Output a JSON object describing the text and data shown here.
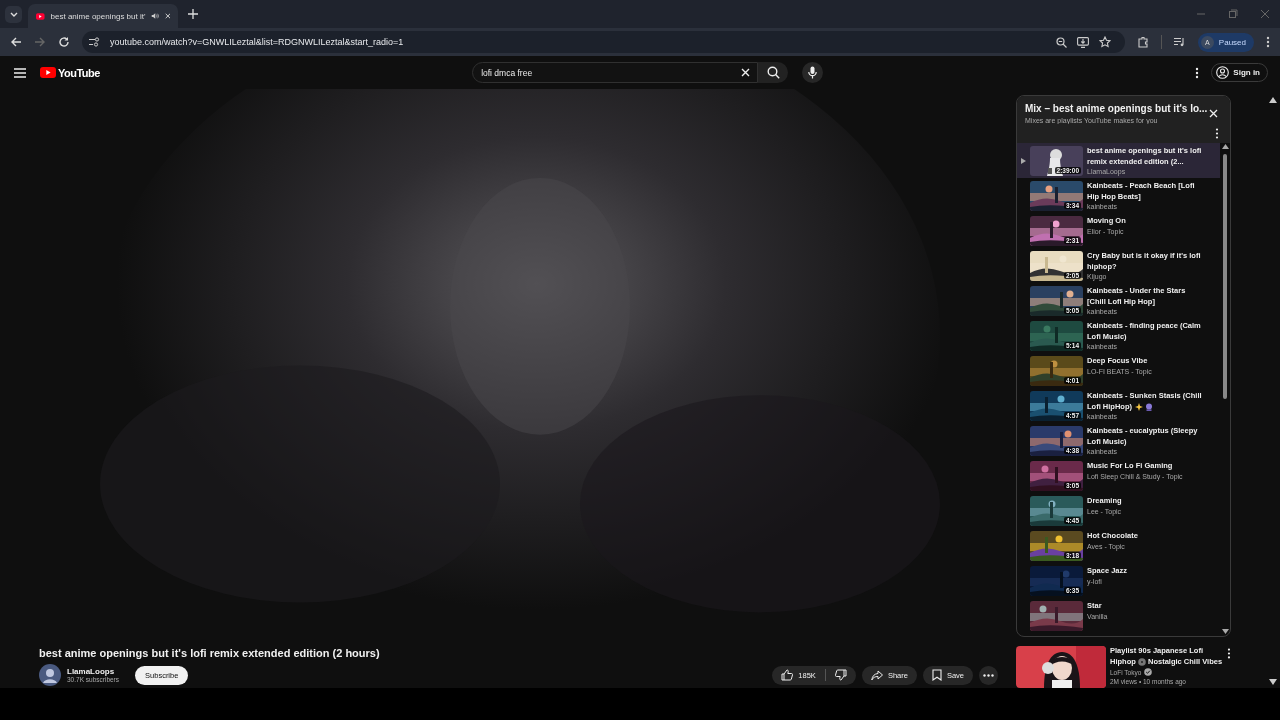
{
  "browser": {
    "tabs": [
      {
        "title": "best anime openings but it'",
        "audio": true,
        "selected": true
      }
    ],
    "url": "youtube.com/watch?v=GNWLILeztal&list=RDGNWLILeztal&start_radio=1",
    "profile": {
      "initial": "A",
      "status": "Paused"
    }
  },
  "masthead": {
    "logo": "YouTube",
    "search": {
      "value": "lofi dmca free"
    },
    "sign_in": "Sign in"
  },
  "video": {
    "title": "best anime openings but it's lofi remix extended edition (2 hours)",
    "channel": "LlamaLoops",
    "subscribers": "30.7K subscribers",
    "subscribe": "Subscribe",
    "likes": "185K",
    "share": "Share",
    "save": "Save"
  },
  "playlist": {
    "title": "Mix – best anime openings but it's lo...",
    "subtitle": "Mixes are playlists YouTube makes for you",
    "items": [
      {
        "title": "best anime openings but it's lofi remix extended edition (2...",
        "channel": "LlamaLoops",
        "duration": "2:39:00",
        "selected": true
      },
      {
        "title": "Kainbeats - Peach Beach [Lofi Hip Hop Beats]",
        "channel": "kainbeats",
        "duration": "3:34",
        "selected": false
      },
      {
        "title": "Moving On",
        "channel": "Elior - Topic",
        "duration": "2:31",
        "selected": false
      },
      {
        "title": "Cry Baby but is it okay if it's lofi hiphop?",
        "channel": "Kijugo",
        "duration": "2:05",
        "selected": false
      },
      {
        "title": "Kainbeats - Under the Stars [Chill Lofi Hip Hop]",
        "channel": "kainbeats",
        "duration": "5:05",
        "selected": false
      },
      {
        "title": "Kainbeats - finding peace (Calm Lofi Music)",
        "channel": "kainbeats",
        "duration": "5:14",
        "selected": false
      },
      {
        "title": "Deep Focus Vibe",
        "channel": "LO-FI BEATS - Topic",
        "duration": "4:01",
        "selected": false
      },
      {
        "title": "Kainbeats - Sunken Stasis (Chill Lofi HipHop)",
        "channel": "kainbeats",
        "duration": "4:57",
        "selected": false,
        "decorated": true
      },
      {
        "title": "Kainbeats - eucalyptus (Sleepy Lofi Music)",
        "channel": "kainbeats",
        "duration": "4:38",
        "selected": false
      },
      {
        "title": "Music For Lo Fi Gaming",
        "channel": "Lofi Sleep Chill & Study - Topic",
        "duration": "3:05",
        "selected": false
      },
      {
        "title": "Dreaming",
        "channel": "Lee - Topic",
        "duration": "4:45",
        "selected": false
      },
      {
        "title": "Hot Chocolate",
        "channel": "Aves - Topic",
        "duration": "3:18",
        "selected": false
      },
      {
        "title": "Space Jazz",
        "channel": "y-lofi",
        "duration": "6:35",
        "selected": false
      },
      {
        "title": "Star",
        "channel": "Vanilla",
        "selected": false
      }
    ]
  },
  "recommendation": {
    "title_parts": [
      "Playlist 90s Japanese Lofi Hiphop",
      "Nostalgic Chill Vibes"
    ],
    "channel": "LoFi Tokyo",
    "verified": true,
    "meta": "2M views • 10 months ago"
  }
}
